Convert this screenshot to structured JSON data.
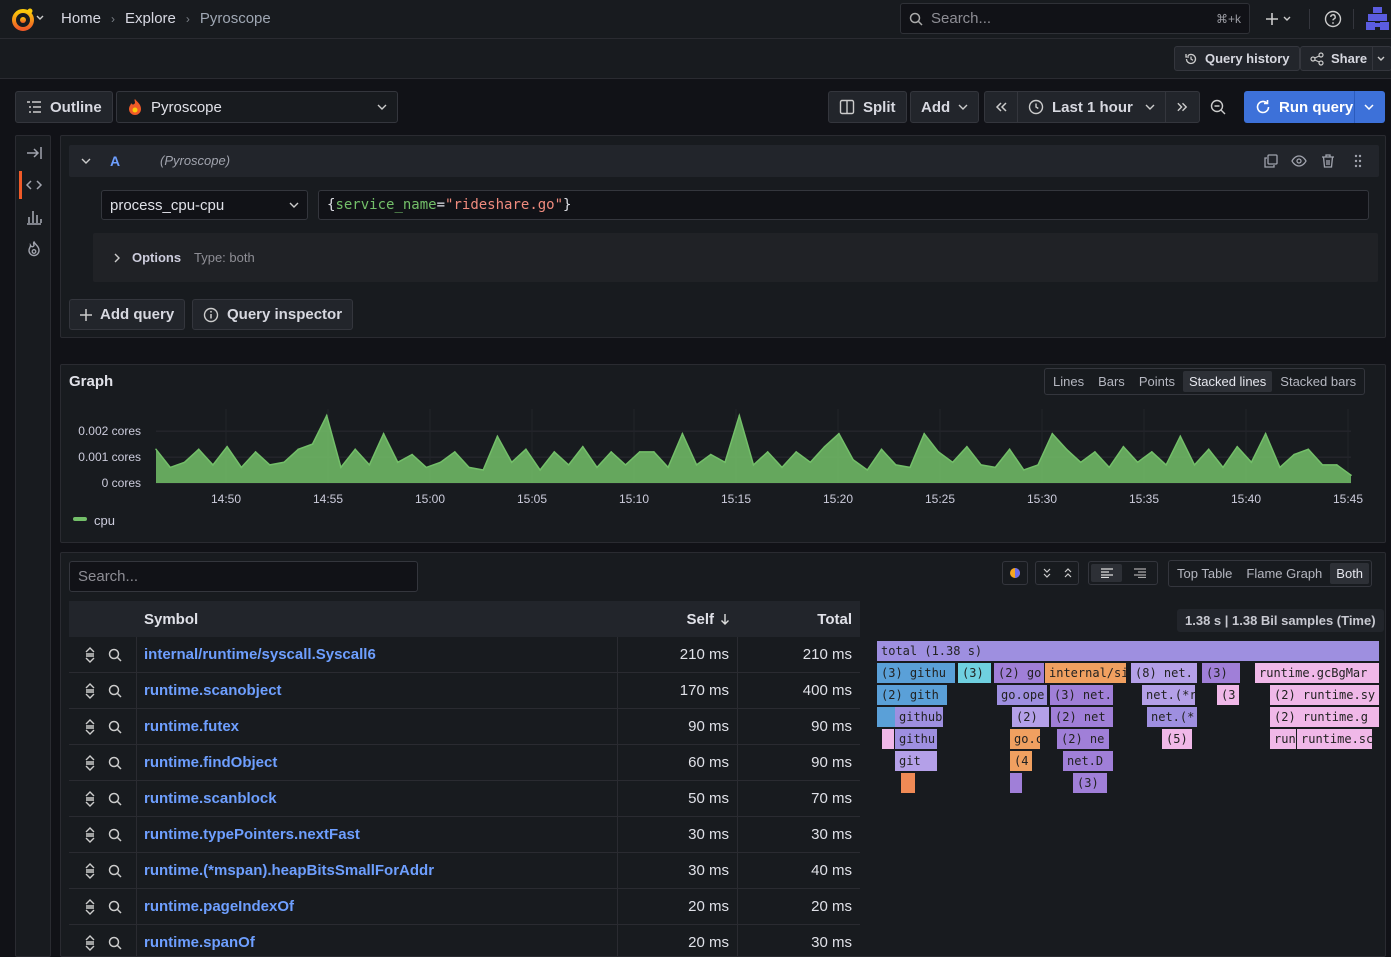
{
  "header": {
    "breadcrumbs": [
      "Home",
      "Explore",
      "Pyroscope"
    ],
    "search_placeholder": "Search...",
    "search_shortcut": "⌘+k"
  },
  "subbar": {
    "query_history": "Query history",
    "share": "Share"
  },
  "toolbar": {
    "outline": "Outline",
    "datasource": "Pyroscope",
    "split": "Split",
    "add": "Add",
    "time_range": "Last 1 hour",
    "run_query": "Run query"
  },
  "query": {
    "ref_id": "A",
    "datasource_label": "(Pyroscope)",
    "profile_type": "process_cpu-cpu",
    "label_selector": {
      "open": "{",
      "key": "service_name",
      "eq": "=",
      "value": "\"rideshare.go\"",
      "close": "}"
    },
    "options_label": "Options",
    "options_type": "Type: both",
    "add_query": "Add query",
    "query_inspector": "Query inspector"
  },
  "graph": {
    "title": "Graph",
    "modes": [
      "Lines",
      "Bars",
      "Points",
      "Stacked lines",
      "Stacked bars"
    ],
    "active_mode": "Stacked lines",
    "legend": "cpu",
    "color": "#73bf69"
  },
  "chart_data": {
    "type": "area",
    "title": "Graph",
    "y_ticks": [
      "0.002 cores",
      "0.001 cores",
      "0 cores"
    ],
    "x_ticks": [
      "14:50",
      "14:55",
      "15:00",
      "15:05",
      "15:10",
      "15:15",
      "15:20",
      "15:25",
      "15:30",
      "15:35",
      "15:40",
      "15:45"
    ],
    "ylim": [
      0,
      0.0027
    ],
    "series": [
      {
        "name": "cpu",
        "values": [
          0.0013,
          0.0006,
          0.0008,
          0.0013,
          0.0007,
          0.0014,
          0.0006,
          0.0012,
          0.0007,
          0.0008,
          0.0013,
          0.0015,
          0.0026,
          0.0006,
          0.0013,
          0.0007,
          0.0019,
          0.0008,
          0.0011,
          0.0006,
          0.0008,
          0.0012,
          0.0006,
          0.0005,
          0.0018,
          0.0008,
          0.0013,
          0.0005,
          0.0012,
          0.0007,
          0.0014,
          0.0006,
          0.0012,
          0.0007,
          0.0012,
          0.0012,
          0.0006,
          0.0019,
          0.0007,
          0.0011,
          0.0008,
          0.0026,
          0.0007,
          0.0012,
          0.0006,
          0.0012,
          0.0008,
          0.0014,
          0.0019,
          0.0009,
          0.0005,
          0.0013,
          0.0007,
          0.0006,
          0.0019,
          0.0012,
          0.0008,
          0.0014,
          0.0007,
          0.0006,
          0.0013,
          0.0005,
          0.0007,
          0.0019,
          0.0013,
          0.0008,
          0.0012,
          0.0006,
          0.0014,
          0.0008,
          0.0012,
          0.0007,
          0.0018,
          0.0007,
          0.0013,
          0.0006,
          0.0014,
          0.0008,
          0.0019,
          0.0006,
          0.0011,
          0.0013,
          0.0007,
          0.0007,
          0.0003
        ]
      }
    ]
  },
  "flamegraph": {
    "search_placeholder": "Search...",
    "views": [
      "Top Table",
      "Flame Graph",
      "Both"
    ],
    "active_view": "Both",
    "summary": "1.38 s | 1.38 Bil samples (Time)",
    "columns": [
      "Symbol",
      "Self",
      "Total"
    ],
    "rows": [
      {
        "symbol": "internal/runtime/syscall.Syscall6",
        "self": "210 ms",
        "total": "210 ms"
      },
      {
        "symbol": "runtime.scanobject",
        "self": "170 ms",
        "total": "400 ms"
      },
      {
        "symbol": "runtime.futex",
        "self": "90 ms",
        "total": "90 ms"
      },
      {
        "symbol": "runtime.findObject",
        "self": "60 ms",
        "total": "90 ms"
      },
      {
        "symbol": "runtime.scanblock",
        "self": "50 ms",
        "total": "70 ms"
      },
      {
        "symbol": "runtime.typePointers.nextFast",
        "self": "30 ms",
        "total": "30 ms"
      },
      {
        "symbol": "runtime.(*mspan).heapBitsSmallForAddr",
        "self": "30 ms",
        "total": "40 ms"
      },
      {
        "symbol": "runtime.pageIndexOf",
        "self": "20 ms",
        "total": "20 ms"
      },
      {
        "symbol": "runtime.spanOf",
        "self": "20 ms",
        "total": "30 ms"
      }
    ],
    "frame_labels": [
      "total (1.38 s)",
      "(3) githu",
      "(3)",
      "(2) go",
      "internal/si",
      "(8) net.",
      "(3)",
      "runtime.gcBgMar",
      "(2) gith",
      "go.ope",
      "(3) net.",
      "net.(*r",
      "(3",
      "(2) runtime.sy",
      "github",
      "(2)",
      "(2) net",
      "net.(*",
      "(2) runtime.g",
      "githu",
      "go.c",
      "(2) ne",
      "(5)",
      "run",
      "runtime.sc",
      "git",
      "(4",
      "net.D",
      "(3)"
    ]
  }
}
